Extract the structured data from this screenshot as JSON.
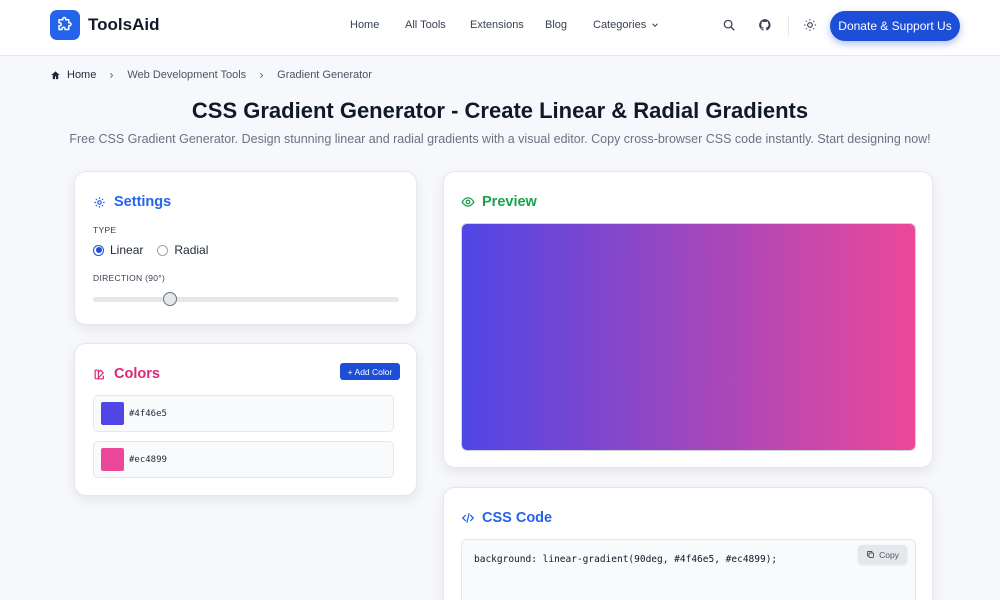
{
  "header": {
    "logo_text": "ToolsAid",
    "nav": [
      "Home",
      "All Tools",
      "Extensions",
      "Blog",
      "Categories"
    ],
    "donate_label": "Donate & Support Us"
  },
  "breadcrumb": [
    "Home",
    "Web Development Tools",
    "Gradient Generator"
  ],
  "page": {
    "title": "CSS Gradient Generator - Create Linear & Radial Gradients",
    "subtitle": "Free CSS Gradient Generator. Design stunning linear and radial gradients with a visual editor. Copy cross-browser CSS code instantly. Start designing now!"
  },
  "settings": {
    "title": "Settings",
    "type_label": "TYPE",
    "type_options": [
      "Linear",
      "Radial"
    ],
    "selected_type": "Linear",
    "direction_label": "DIRECTION (90°)",
    "direction_value": 90,
    "direction_max": 360
  },
  "colors": {
    "title": "Colors",
    "add_label": "+ Add Color",
    "items": [
      {
        "hex": "#4f46e5"
      },
      {
        "hex": "#ec4899"
      }
    ]
  },
  "preview": {
    "title": "Preview"
  },
  "css_code": {
    "title": "CSS Code",
    "code": "background: linear-gradient(90deg, #4f46e5, #ec4899);",
    "copy_label": "Copy"
  },
  "theme": {
    "accent": "#1d4ed8",
    "settings_color": "#2563eb",
    "colors_color": "#db2777",
    "preview_color": "#16a34a",
    "code_color": "#2563eb"
  }
}
